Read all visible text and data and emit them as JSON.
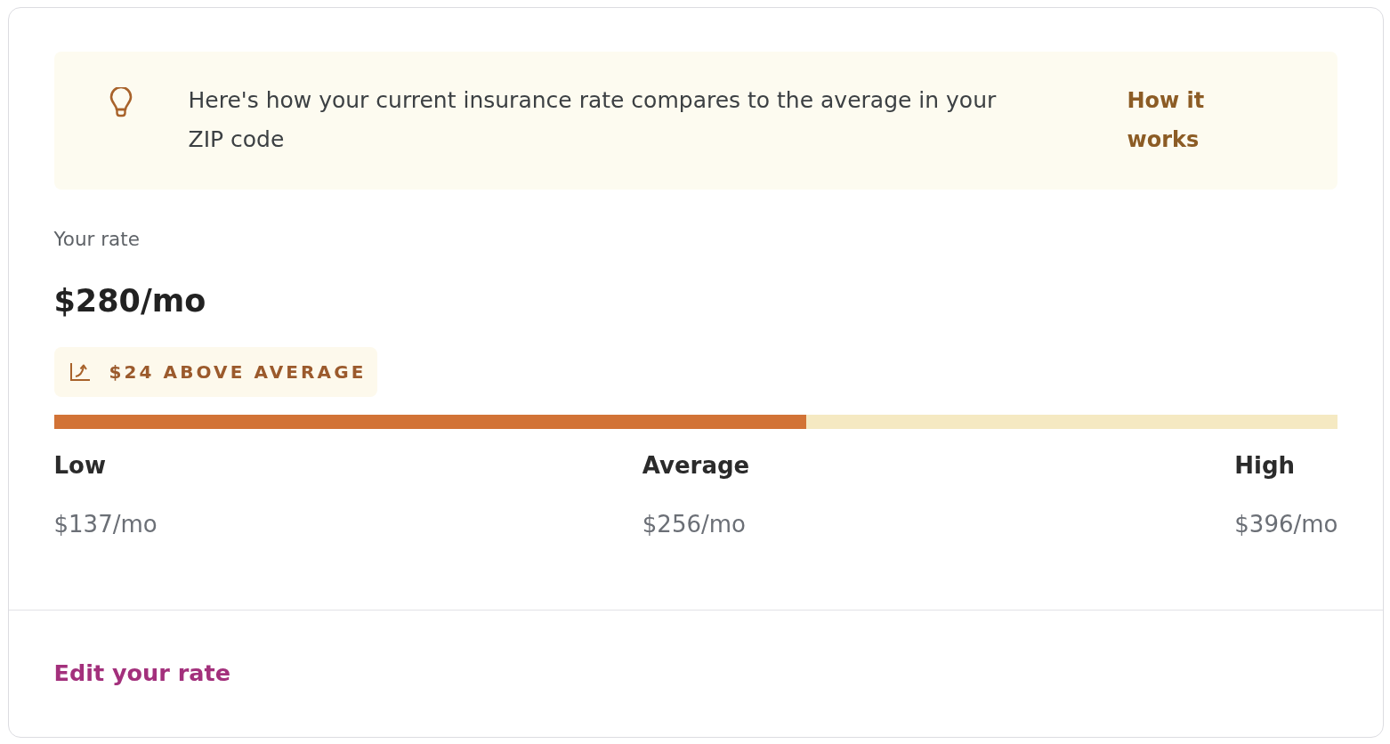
{
  "banner": {
    "message": "Here's how your current insurance rate compares to the average in your ZIP code",
    "link": "How it works"
  },
  "rate": {
    "label": "Your rate",
    "amount": "$280/mo",
    "comparison": "$24 ABOVE AVERAGE"
  },
  "range_bar": {
    "level": 0.586
  },
  "scale": [
    {
      "label": "Low",
      "value": "$137/mo"
    },
    {
      "label": "Average",
      "value": "$256/mo"
    },
    {
      "label": "High",
      "value": "$396/mo"
    }
  ],
  "footer": {
    "link": "Edit your rate"
  }
}
